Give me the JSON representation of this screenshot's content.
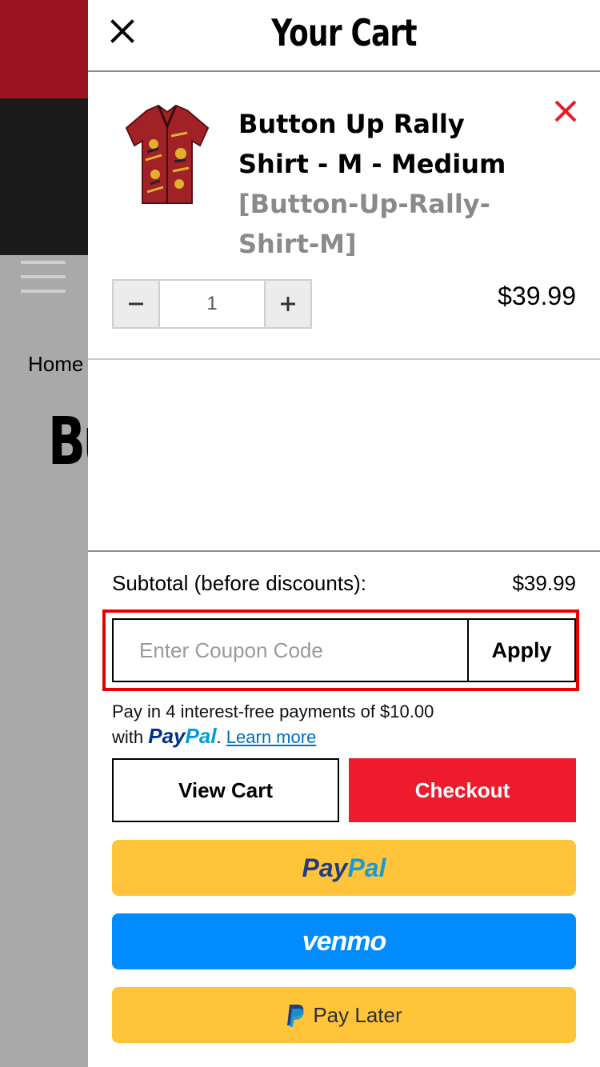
{
  "background": {
    "breadcrumb_home": "Home",
    "title_fragment": "Bu"
  },
  "cart": {
    "title": "Your Cart",
    "item": {
      "name": "Button Up Rally Shirt - M - Medium",
      "sku": "[Button-Up-Rally-Shirt-M]",
      "quantity": "1",
      "price": "$39.99"
    },
    "subtotal_label": "Subtotal (before discounts):",
    "subtotal_value": "$39.99",
    "coupon": {
      "placeholder": "Enter Coupon Code",
      "value": "",
      "apply_label": "Apply"
    },
    "paypal_message": {
      "line1": "Pay in 4 interest-free payments of $10.00",
      "with": "with",
      "logo_pay": "Pay",
      "logo_pal": "Pal",
      "period": ".",
      "learn_more": "Learn more"
    },
    "view_cart_label": "View Cart",
    "checkout_label": "Checkout",
    "paypal_button": {
      "pay": "Pay",
      "pal": "Pal"
    },
    "venmo_button": "venmo",
    "pay_later_button": "Pay Later"
  },
  "colors": {
    "checkout": "#ee1b2f",
    "paypal_yellow": "#ffc439",
    "venmo_blue": "#008cff",
    "remove_x": "#e8192c",
    "highlight": "#e60000"
  }
}
